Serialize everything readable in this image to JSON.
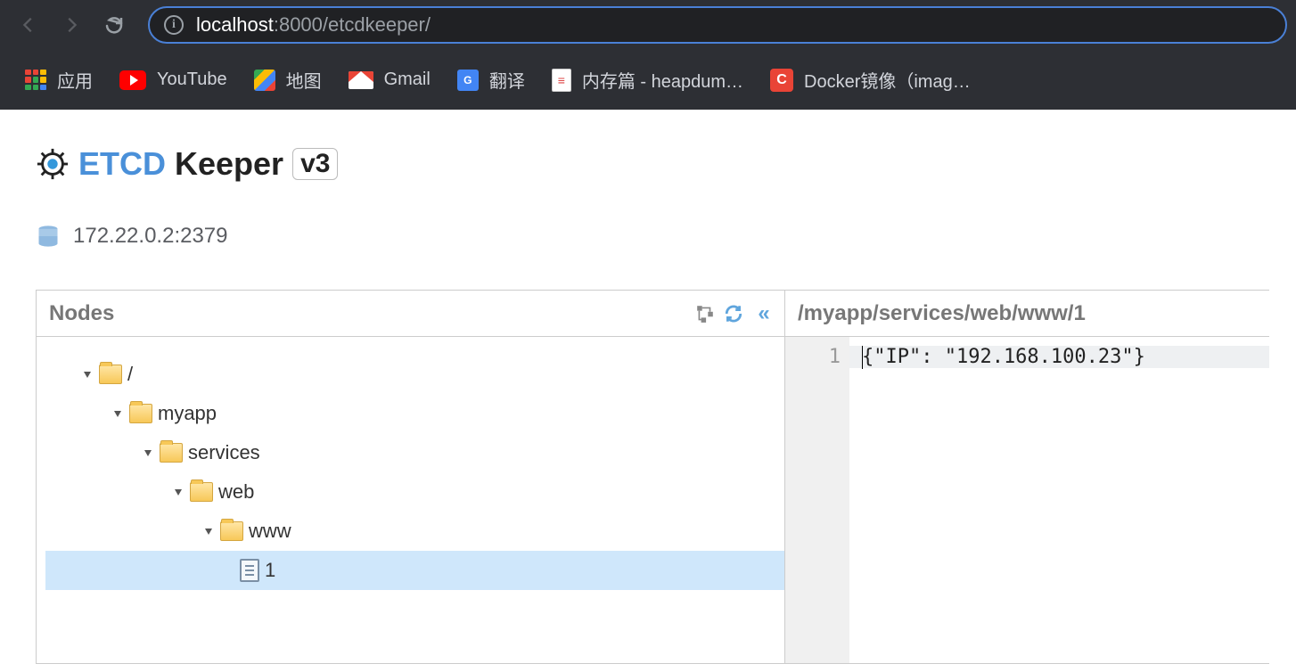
{
  "browser": {
    "url_host": "localhost",
    "url_port": ":8000",
    "url_path": "/etcdkeeper/"
  },
  "bookmarks": {
    "apps": "应用",
    "youtube": "YouTube",
    "maps": "地图",
    "gmail": "Gmail",
    "translate": "翻译",
    "heapdump": "内存篇 - heapdum…",
    "docker": "Docker镜像（imag…"
  },
  "app": {
    "title_brand": "ETCD",
    "title_name": "Keeper",
    "version": "v3",
    "server_address": "172.22.0.2:2379"
  },
  "left_panel": {
    "title": "Nodes",
    "tree": {
      "root": "/",
      "level1": "myapp",
      "level2": "services",
      "level3": "web",
      "level4": "www",
      "leaf": "1"
    }
  },
  "right_panel": {
    "path": "/myapp/services/web/www/1",
    "gutter_1": "1",
    "line_1": "{\"IP\": \"192.168.100.23\"}"
  }
}
